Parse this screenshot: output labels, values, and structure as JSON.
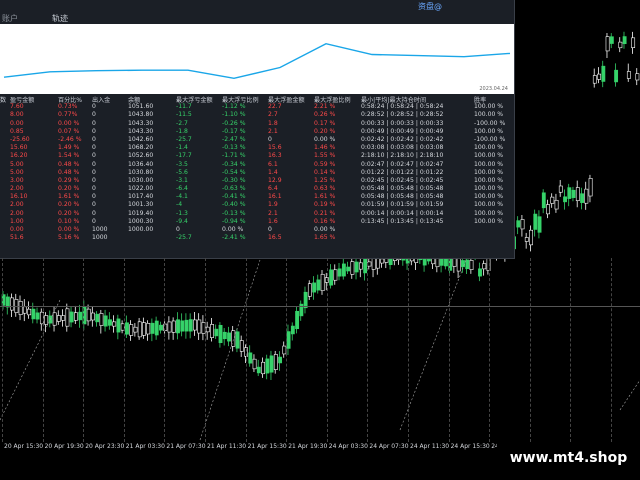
{
  "panel": {
    "title": "资盘@",
    "tabs": [
      {
        "label": "账户",
        "active": false
      },
      {
        "label": "轨迹",
        "active": true
      }
    ],
    "equity_date": "2023.04.24"
  },
  "table": {
    "headers": [
      "数",
      "盈亏金额",
      "百分比%",
      "出入金",
      "余额",
      "最大浮亏金额",
      "最大浮亏比例",
      "最大浮盈金额",
      "最大浮盈比例",
      "最小|平均|最大持仓时间",
      "胜率"
    ],
    "rows": [
      [
        "",
        "7.60",
        "0.73%",
        "0",
        "1051.60",
        "-11.7",
        "-1.12 %",
        "22.7",
        "2.21 %",
        "0:58:24 | 0:58:24 | 0:58:24",
        "100.00 %"
      ],
      [
        "",
        "8.00",
        "0.77%",
        "0",
        "1043.80",
        "-11.5",
        "-1.10 %",
        "2.7",
        "0.26 %",
        "0:28:52 | 0:28:52 | 0:28:52",
        "100.00 %"
      ],
      [
        "",
        "0.00",
        "0.00 %",
        "0",
        "1043.30",
        "-2.7",
        "-0.26 %",
        "1.8",
        "0.17 %",
        "0:00:33 | 0:00:33 | 0:00:33",
        "-100.00 %"
      ],
      [
        "",
        "0.85",
        "0.07 %",
        "0",
        "1043.30",
        "-1.8",
        "-0.17 %",
        "2.1",
        "0.20 %",
        "0:00:49 | 0:00:49 | 0:00:49",
        "100.00 %"
      ],
      [
        "",
        "-25.60",
        "-2.46 %",
        "0",
        "1042.60",
        "-25.7",
        "-2.47 %",
        "0",
        "0.00 %",
        "0:02:42 | 0:02:42 | 0:02:42",
        "-100.00 %"
      ],
      [
        "",
        "15.60",
        "1.49 %",
        "0",
        "1068.20",
        "-1.4",
        "-0.13 %",
        "15.6",
        "1.46 %",
        "0:03:08 | 0:03:08 | 0:03:08",
        "100.00 %"
      ],
      [
        "",
        "16.20",
        "1.54 %",
        "0",
        "1052.60",
        "-17.7",
        "-1.71 %",
        "16.3",
        "1.55 %",
        "2:18:10 | 2:18:10 | 2:18:10",
        "100.00 %"
      ],
      [
        "",
        "5.00",
        "0.48 %",
        "0",
        "1036.40",
        "-3.5",
        "-0.34 %",
        "6.1",
        "0.59 %",
        "0:02:47 | 0:02:47 | 0:02:47",
        "100.00 %"
      ],
      [
        "",
        "5.00",
        "0.48 %",
        "0",
        "1030.80",
        "-5.6",
        "-0.54 %",
        "1.4",
        "0.14 %",
        "0:01:22 | 0:01:22 | 0:01:22",
        "100.00 %"
      ],
      [
        "",
        "3.00",
        "0.29 %",
        "0",
        "1030.00",
        "-3.1",
        "-0.30 %",
        "12.9",
        "1.25 %",
        "0:02:45 | 0:02:45 | 0:02:45",
        "100.00 %"
      ],
      [
        "",
        "2.00",
        "0.20 %",
        "0",
        "1022.00",
        "-6.4",
        "-0.63 %",
        "6.4",
        "0.63 %",
        "0:05:48 | 0:05:48 | 0:05:48",
        "100.00 %"
      ],
      [
        "",
        "16.10",
        "1.61 %",
        "0",
        "1017.40",
        "-4.1",
        "-0.41 %",
        "16.1",
        "1.61 %",
        "0:05:48 | 0:05:48 | 0:05:48",
        "100.00 %"
      ],
      [
        "",
        "2.00",
        "0.20 %",
        "0",
        "1001.30",
        "-4",
        "-0.40 %",
        "1.9",
        "0.19 %",
        "0:01:59 | 0:01:59 | 0:01:59",
        "100.00 %"
      ],
      [
        "",
        "2.00",
        "0.20 %",
        "0",
        "1019.40",
        "-1.3",
        "-0.13 %",
        "2.1",
        "0.21 %",
        "0:00:14 | 0:00:14 | 0:00:14",
        "100.00 %"
      ],
      [
        "",
        "1.00",
        "0.10 %",
        "0",
        "1000.30",
        "-9.4",
        "-0.94 %",
        "1.6",
        "0.16 %",
        "0:13:45 | 0:13:45 | 0:13:45",
        "100.00 %"
      ],
      [
        "",
        "0.00",
        "0.00 %",
        "1000",
        "1000.00",
        "0",
        "0.00 %",
        "0",
        "0.00 %",
        "",
        ""
      ],
      [
        "",
        "51.6",
        "5.16 %",
        "1000",
        "",
        "-25.7",
        "-2.41 %",
        "16.5",
        "1.65 %",
        "",
        ""
      ]
    ]
  },
  "equity_curve": [
    0.2,
    0.3,
    0.32,
    0.33,
    0.33,
    0.18,
    0.38,
    0.82,
    0.62,
    0.6,
    0.58,
    0.64
  ],
  "xaxis_ticks": [
    "20 Apr 15:30",
    "20 Apr 19:30",
    "20 Apr 23:30",
    "21 Apr 03:30",
    "21 Apr 07:30",
    "21 Apr 11:30",
    "21 Apr 15:30",
    "21 Apr 19:30",
    "24 Apr 03:30",
    "24 Apr 07:30",
    "24 Apr 11:30",
    "24 Apr 15:30",
    "24 Apr 19:30",
    "24 Apr 23:30",
    "25 Apr 03:30",
    "25 Apr 07:30"
  ],
  "watermark": "www.mt4.shop",
  "colors": {
    "bull": "#36d36a",
    "bear": "#ffffff",
    "equity": "#1aa6e8",
    "loss": "#ff4a4a",
    "gain": "#36d36a"
  }
}
